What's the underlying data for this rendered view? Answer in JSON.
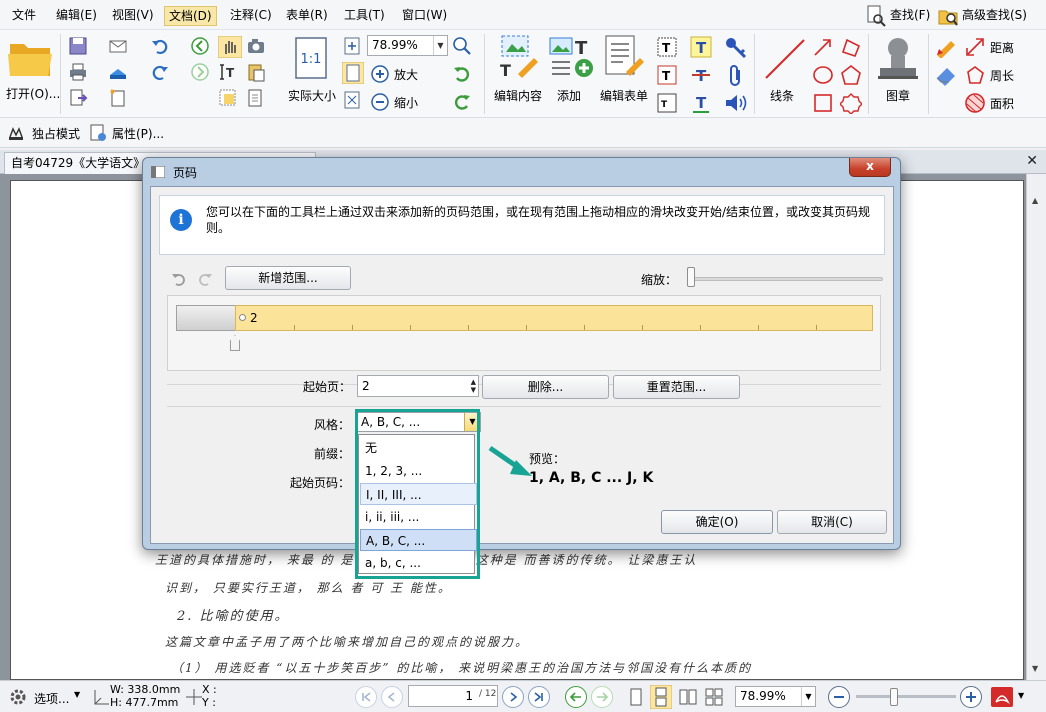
{
  "menu": {
    "items": [
      "文件",
      "编辑(E)",
      "视图(V)",
      "文档(D)",
      "注释(C)",
      "表单(R)",
      "工具(T)",
      "窗口(W)"
    ],
    "active": "文档(D)",
    "right": [
      "查找(F)",
      "高级查找(S)"
    ]
  },
  "ribbon": {
    "open_label": "打开(O)...",
    "actual_size_label": "实际大小",
    "zoom_value": "78.99%",
    "zoom_in_label": "放大",
    "zoom_out_label": "缩小",
    "edit_content_label": "编辑内容",
    "add_label": "添加",
    "edit_form_label": "编辑表单",
    "lines_label": "线条",
    "stamp_label": "图章",
    "distance_label": "距离",
    "perimeter_label": "周长",
    "area_label": "面积"
  },
  "subbar": {
    "exclusive_mode": "独占模式",
    "properties": "属性(P)..."
  },
  "tab": {
    "title": "自考04729《大学语文》"
  },
  "document": {
    "lines": [
      "王道的具体措施时， 来最 的  是的   道的  是治  序；  这种是   而善诱的传统。  让梁惠王认",
      "识到， 只要实行王道， 那么   者  可  王  能性。",
      "2.  比喻的使用。",
      "这篇文章中孟子用了两个比喻来增加自己的观点的说服力。",
      "（1）  用选贬者 “以五十步笑百步” 的比喻， 来说明梁惠王的治国方法与邻国没有什么本质的"
    ]
  },
  "status": {
    "options": "选项...",
    "width": "W: 338.0mm",
    "height": "H: 477.7mm",
    "x": "X :",
    "y": "Y :",
    "page_current": "1",
    "page_total": "/ 12",
    "zoom": "78.99%"
  },
  "dialog": {
    "title": "页码",
    "close": "x",
    "info": "您可以在下面的工具栏上通过双击来添加新的页码范围，或在现有范围上拖动相应的滑块改变开始/结束位置，或改变其页码规则。",
    "new_range": "新增范围...",
    "zoom_label": "缩放：",
    "range_label": "2",
    "start_page_label": "起始页：",
    "start_page_value": "2",
    "delete": "删除...",
    "reset_range": "重置范围...",
    "style_label": "风格：",
    "style_value": "A, B, C, ...",
    "prefix_label": "前缀：",
    "start_number_label": "起始页码：",
    "style_options": [
      "无",
      "1, 2, 3, ...",
      "I, II, III, ...",
      "i, ii, iii, ...",
      "A, B, C, ...",
      "a, b, c, ..."
    ],
    "preview_label": "预览：",
    "preview_value": "1, A, B, C ... J, K",
    "ok": "确定(O)",
    "cancel": "取消(C)"
  },
  "colors": {
    "accent": "#17a495",
    "range_bar": "#fce39a",
    "info_icon": "#1e73d6"
  }
}
